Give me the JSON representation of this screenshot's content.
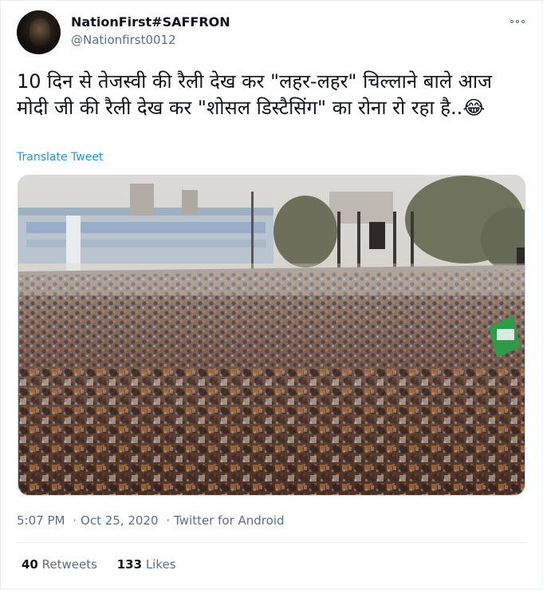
{
  "tweet": {
    "display_name": "NationFirst#SAFFRON",
    "handle": "@Nationfirst0012",
    "text": "10 दिन से तेजस्वी की रैली देख कर \"लहर-लहर\" चिल्लाने बाले आज मोदी जी की रैली देख कर \"शोसल डिस्टैसिंग\" का रोना रो रहा है..😂",
    "translate_label": "Translate Tweet",
    "time": "5:07 PM",
    "date": "Oct 25, 2020",
    "separator": "·",
    "source": "Twitter for Android",
    "retweets_count": "40",
    "retweets_label": "Retweets",
    "likes_count": "133",
    "likes_label": "Likes",
    "more_icon": "more-horizontal-icon"
  },
  "colors": {
    "text": "#0f1419",
    "secondary": "#5b7083",
    "link": "#1b95e0",
    "border": "#e6ecf0"
  }
}
